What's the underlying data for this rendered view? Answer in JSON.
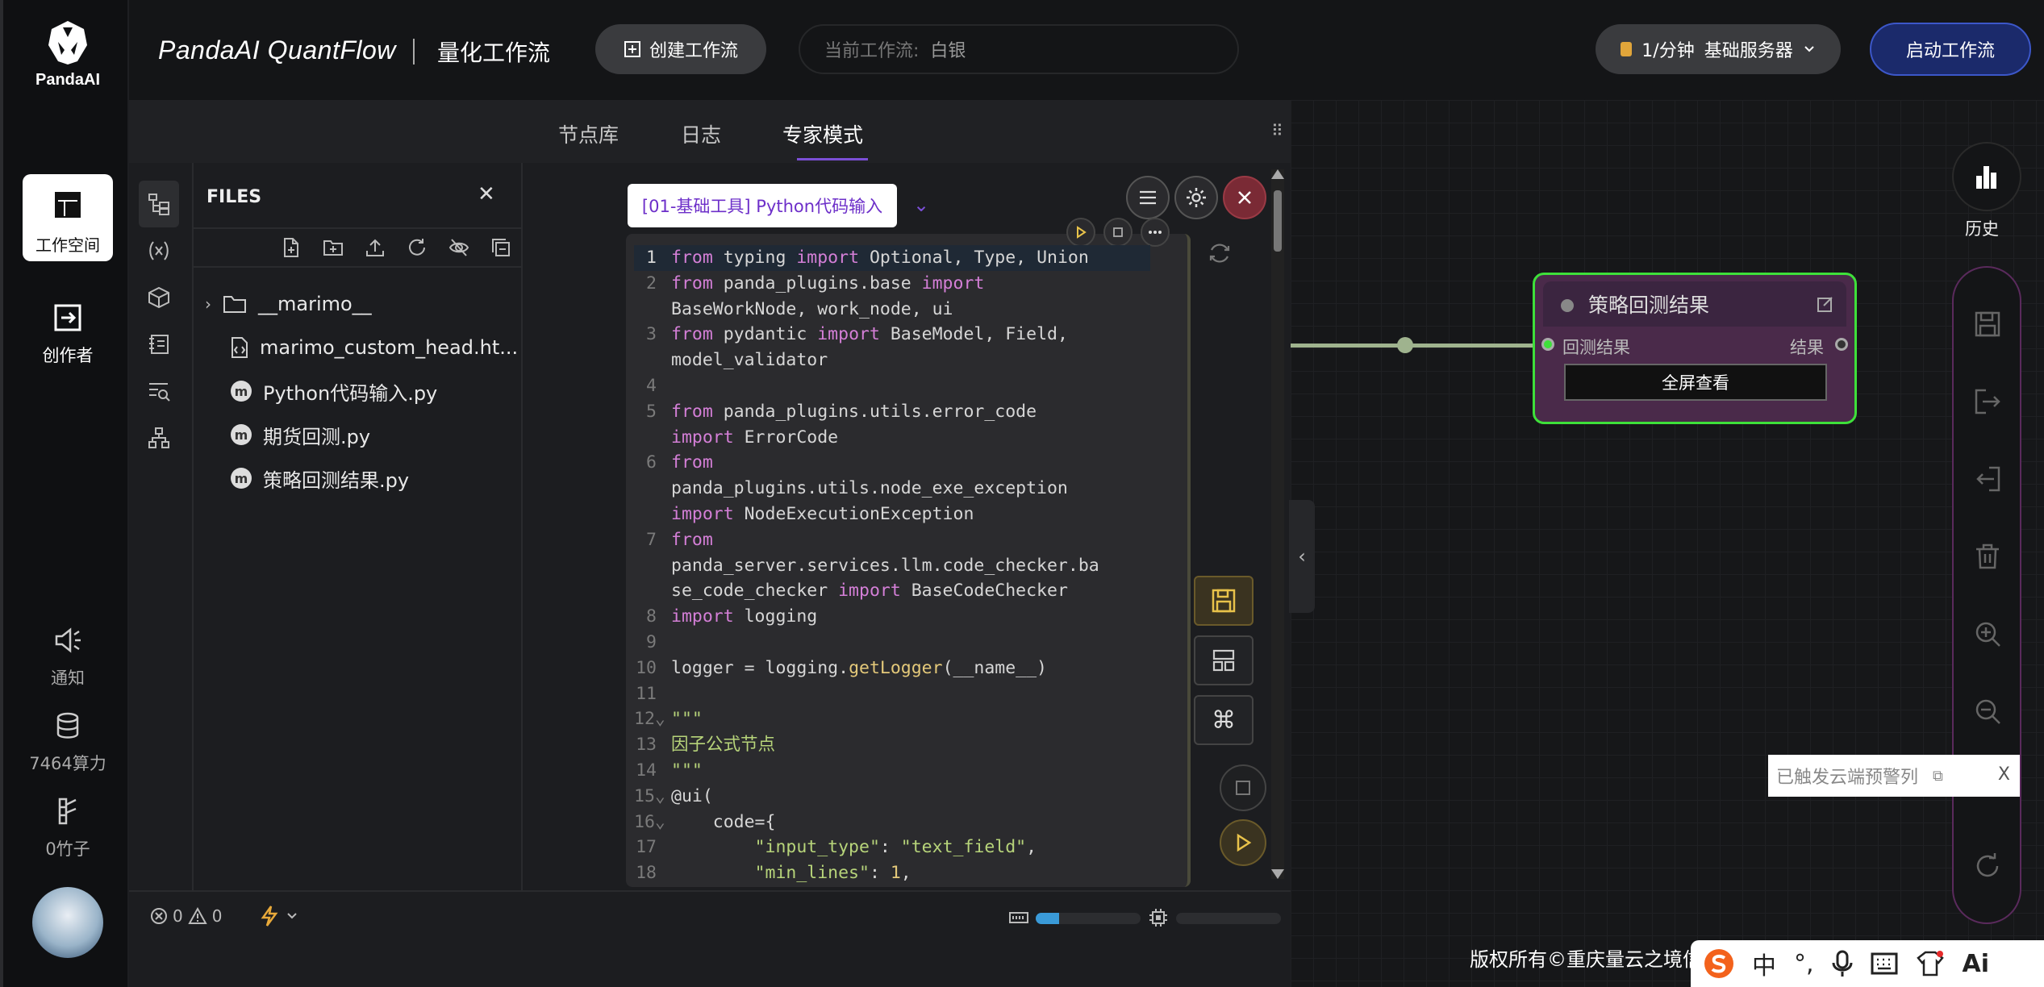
{
  "sidebar": {
    "logo_text": "PandaAI",
    "workspace_label": "工作空间",
    "creator_label": "创作者",
    "notify_label": "通知",
    "compute_label": "7464算力",
    "bamboo_label": "0竹子"
  },
  "header": {
    "brand": "PandaAI QuantFlow",
    "subtitle": "量化工作流",
    "create_label": "创建工作流",
    "current_prefix": "当前工作流:",
    "current_value": "白银",
    "rate_label": "1/分钟",
    "server_label": "基础服务器",
    "start_label": "启动工作流"
  },
  "tabs": [
    "节点库",
    "日志",
    "专家模式"
  ],
  "files": {
    "title": "FILES",
    "items": [
      {
        "name": "__marimo__",
        "kind": "folder"
      },
      {
        "name": "marimo_custom_head.ht...",
        "kind": "file"
      },
      {
        "name": "Python代码输入.py",
        "kind": "marimo"
      },
      {
        "name": "期货回测.py",
        "kind": "marimo"
      },
      {
        "name": "策略回测结果.py",
        "kind": "marimo"
      }
    ]
  },
  "editor": {
    "node_title": "[01-基础工具] Python代码输入",
    "errors": "0",
    "warnings": "0",
    "memory_usage": 0.22,
    "cpu_usage": 0.0
  },
  "result_node": {
    "title": "策略回测结果",
    "input_label": "回测结果",
    "output_label": "结果",
    "fullscreen_label": "全屏查看"
  },
  "right_toolbar": {
    "history_label": "历史"
  },
  "toast": {
    "text": "已触发云端预警列",
    "close": "X"
  },
  "footer": {
    "copyright": "版权所有©重庆量云之境信"
  },
  "ime": {
    "lang": "中",
    "punct": "°,",
    "ai": "Ai"
  },
  "colors": {
    "accent_purple": "#7b4fd6",
    "node_border_green": "#3ee03a",
    "start_button": "#1b2a6b"
  }
}
